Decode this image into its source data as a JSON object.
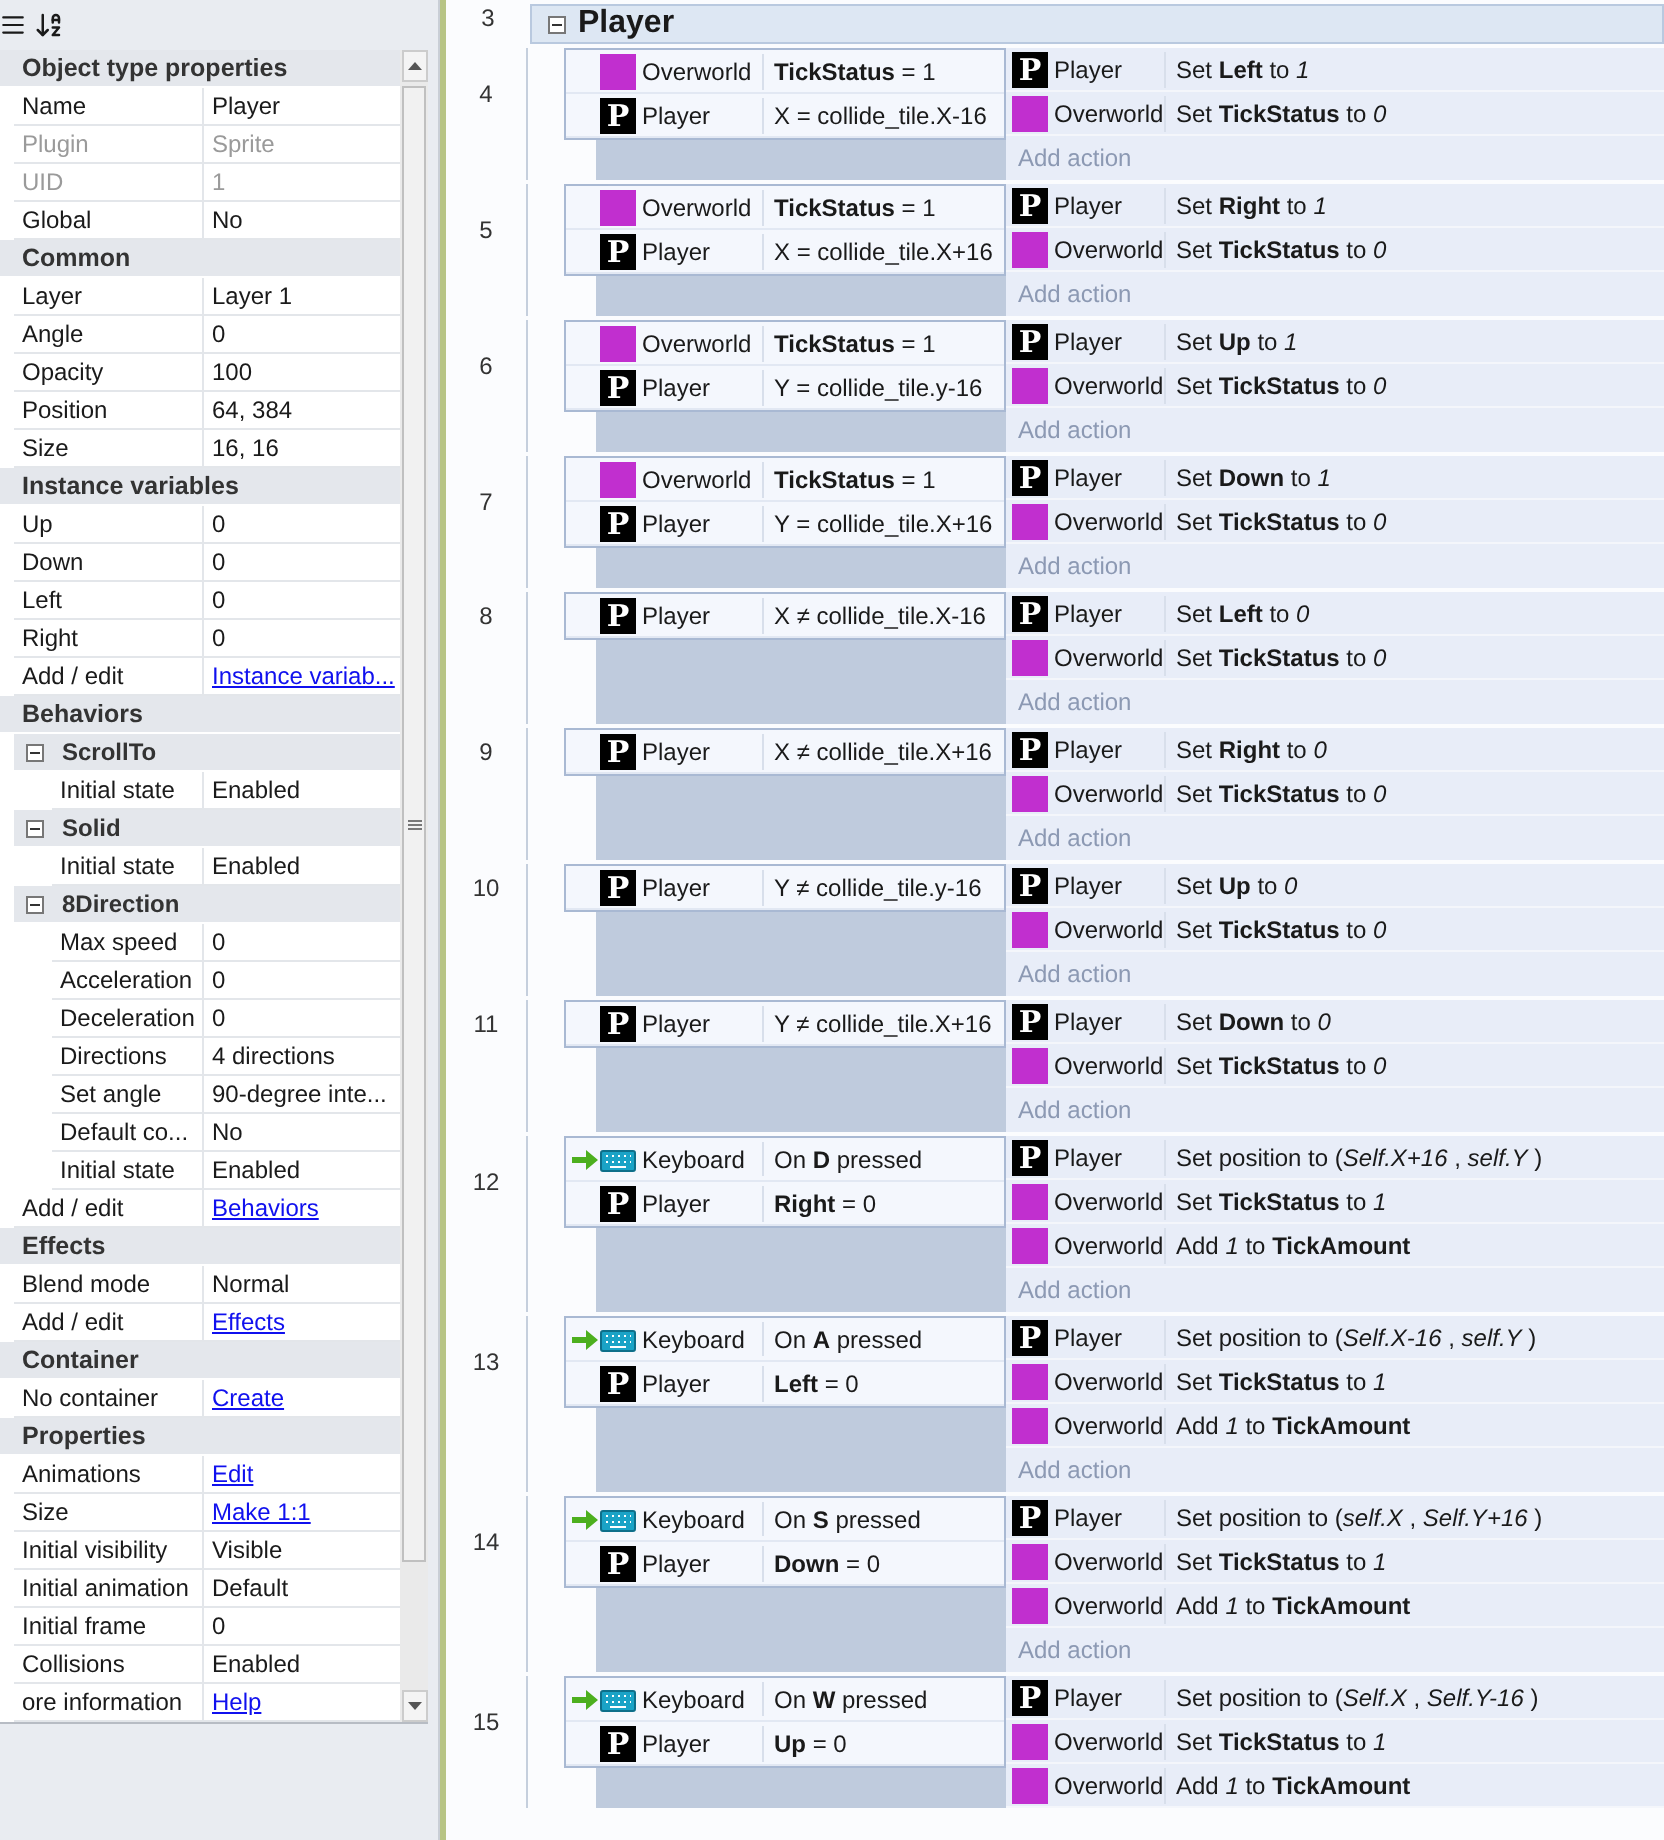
{
  "properties": {
    "sections": [
      {
        "title": "Object type properties",
        "items": [
          {
            "kind": "row",
            "label": "Name",
            "value": "Player",
            "link": false,
            "disabled": false
          },
          {
            "kind": "row",
            "label": "Plugin",
            "value": "Sprite",
            "link": false,
            "disabled": true
          },
          {
            "kind": "row",
            "label": "UID",
            "value": "1",
            "link": false,
            "disabled": true
          },
          {
            "kind": "row",
            "label": "Global",
            "value": "No",
            "link": false,
            "disabled": false
          }
        ]
      },
      {
        "title": "Common",
        "items": [
          {
            "kind": "row",
            "label": "Layer",
            "value": "Layer 1",
            "link": false,
            "disabled": false
          },
          {
            "kind": "row",
            "label": "Angle",
            "value": "0",
            "link": false,
            "disabled": false
          },
          {
            "kind": "row",
            "label": "Opacity",
            "value": "100",
            "link": false,
            "disabled": false
          },
          {
            "kind": "row",
            "label": "Position",
            "value": "64, 384",
            "link": false,
            "disabled": false
          },
          {
            "kind": "row",
            "label": "Size",
            "value": "16, 16",
            "link": false,
            "disabled": false
          }
        ]
      },
      {
        "title": "Instance variables",
        "items": [
          {
            "kind": "row",
            "label": "Up",
            "value": "0",
            "link": false,
            "disabled": false
          },
          {
            "kind": "row",
            "label": "Down",
            "value": "0",
            "link": false,
            "disabled": false
          },
          {
            "kind": "row",
            "label": "Left",
            "value": "0",
            "link": false,
            "disabled": false
          },
          {
            "kind": "row",
            "label": "Right",
            "value": "0",
            "link": false,
            "disabled": false
          },
          {
            "kind": "row",
            "label": "Add / edit",
            "value": "Instance variab...",
            "link": true,
            "disabled": false
          }
        ]
      },
      {
        "title": "Behaviors",
        "items": [
          {
            "kind": "group",
            "name": "ScrollTo",
            "expanded": true,
            "rows": [
              {
                "label": "Initial state",
                "value": "Enabled"
              }
            ]
          },
          {
            "kind": "group",
            "name": "Solid",
            "expanded": true,
            "rows": [
              {
                "label": "Initial state",
                "value": "Enabled"
              }
            ]
          },
          {
            "kind": "group",
            "name": "8Direction",
            "expanded": true,
            "rows": [
              {
                "label": "Max speed",
                "value": "0"
              },
              {
                "label": "Acceleration",
                "value": "0"
              },
              {
                "label": "Deceleration",
                "value": "0"
              },
              {
                "label": "Directions",
                "value": "4 directions"
              },
              {
                "label": "Set angle",
                "value": "90-degree inte..."
              },
              {
                "label": "Default co...",
                "value": "No"
              },
              {
                "label": "Initial state",
                "value": "Enabled"
              }
            ]
          },
          {
            "kind": "row",
            "label": "Add / edit",
            "value": "Behaviors",
            "link": true,
            "disabled": false
          }
        ]
      },
      {
        "title": "Effects",
        "items": [
          {
            "kind": "row",
            "label": "Blend mode",
            "value": "Normal",
            "link": false,
            "disabled": false
          },
          {
            "kind": "row",
            "label": "Add / edit",
            "value": "Effects",
            "link": true,
            "disabled": false
          }
        ]
      },
      {
        "title": "Container",
        "items": [
          {
            "kind": "row",
            "label": "No container",
            "value": "Create",
            "link": true,
            "disabled": false
          }
        ]
      },
      {
        "title": "Properties",
        "items": [
          {
            "kind": "row",
            "label": "Animations",
            "value": "Edit",
            "link": true,
            "disabled": false
          },
          {
            "kind": "row",
            "label": "Size",
            "value": "Make 1:1",
            "link": true,
            "disabled": false
          },
          {
            "kind": "row",
            "label": "Initial visibility",
            "value": "Visible",
            "link": false,
            "disabled": false
          },
          {
            "kind": "row",
            "label": "Initial animation",
            "value": "Default",
            "link": false,
            "disabled": false
          },
          {
            "kind": "row",
            "label": "Initial frame",
            "value": "0",
            "link": false,
            "disabled": false
          },
          {
            "kind": "row",
            "label": "Collisions",
            "value": "Enabled",
            "link": false,
            "disabled": false
          },
          {
            "kind": "row",
            "label": "ore information",
            "value": "Help",
            "link": true,
            "disabled": false
          }
        ]
      }
    ]
  },
  "event_sheet": {
    "group": {
      "line": "3",
      "title": "Player",
      "expanded": true
    },
    "events": [
      {
        "line": "4",
        "conditions": [
          {
            "object": "Overworld",
            "kind": "family",
            "trigger": false,
            "text": "**TickStatus** = 1"
          },
          {
            "object": "Player",
            "kind": "sprite",
            "badge": "P",
            "trigger": false,
            "text": "X = collide_tile.X-16"
          }
        ],
        "actions": [
          {
            "object": "Player",
            "kind": "sprite",
            "badge": "P",
            "text": "Set **Left** to *1*"
          },
          {
            "object": "Overworld",
            "kind": "family",
            "text": "Set **TickStatus** to *0*"
          }
        ],
        "add_action": "Add action"
      },
      {
        "line": "5",
        "conditions": [
          {
            "object": "Overworld",
            "kind": "family",
            "trigger": false,
            "text": "**TickStatus** = 1"
          },
          {
            "object": "Player",
            "kind": "sprite",
            "badge": "P",
            "trigger": false,
            "text": "X = collide_tile.X+16"
          }
        ],
        "actions": [
          {
            "object": "Player",
            "kind": "sprite",
            "badge": "P",
            "text": "Set **Right** to *1*"
          },
          {
            "object": "Overworld",
            "kind": "family",
            "text": "Set **TickStatus** to *0*"
          }
        ],
        "add_action": "Add action"
      },
      {
        "line": "6",
        "conditions": [
          {
            "object": "Overworld",
            "kind": "family",
            "trigger": false,
            "text": "**TickStatus** = 1"
          },
          {
            "object": "Player",
            "kind": "sprite",
            "badge": "P",
            "trigger": false,
            "text": "Y = collide_tile.y-16"
          }
        ],
        "actions": [
          {
            "object": "Player",
            "kind": "sprite",
            "badge": "P",
            "text": "Set **Up** to *1*"
          },
          {
            "object": "Overworld",
            "kind": "family",
            "text": "Set **TickStatus** to *0*"
          }
        ],
        "add_action": "Add action"
      },
      {
        "line": "7",
        "conditions": [
          {
            "object": "Overworld",
            "kind": "family",
            "trigger": false,
            "text": "**TickStatus** = 1"
          },
          {
            "object": "Player",
            "kind": "sprite",
            "badge": "P",
            "trigger": false,
            "text": "Y = collide_tile.X+16"
          }
        ],
        "actions": [
          {
            "object": "Player",
            "kind": "sprite",
            "badge": "P",
            "text": "Set **Down** to *1*"
          },
          {
            "object": "Overworld",
            "kind": "family",
            "text": "Set **TickStatus** to *0*"
          }
        ],
        "add_action": "Add action"
      },
      {
        "line": "8",
        "conditions": [
          {
            "object": "Player",
            "kind": "sprite",
            "badge": "P",
            "trigger": false,
            "text": "X ≠ collide_tile.X-16"
          }
        ],
        "actions": [
          {
            "object": "Player",
            "kind": "sprite",
            "badge": "P",
            "text": "Set **Left** to *0*"
          },
          {
            "object": "Overworld",
            "kind": "family",
            "text": "Set **TickStatus** to *0*"
          }
        ],
        "add_action": "Add action"
      },
      {
        "line": "9",
        "conditions": [
          {
            "object": "Player",
            "kind": "sprite",
            "badge": "P",
            "trigger": false,
            "text": "X ≠ collide_tile.X+16"
          }
        ],
        "actions": [
          {
            "object": "Player",
            "kind": "sprite",
            "badge": "P",
            "text": "Set **Right** to *0*"
          },
          {
            "object": "Overworld",
            "kind": "family",
            "text": "Set **TickStatus** to *0*"
          }
        ],
        "add_action": "Add action"
      },
      {
        "line": "10",
        "conditions": [
          {
            "object": "Player",
            "kind": "sprite",
            "badge": "P",
            "trigger": false,
            "text": "Y ≠ collide_tile.y-16"
          }
        ],
        "actions": [
          {
            "object": "Player",
            "kind": "sprite",
            "badge": "P",
            "text": "Set **Up** to *0*"
          },
          {
            "object": "Overworld",
            "kind": "family",
            "text": "Set **TickStatus** to *0*"
          }
        ],
        "add_action": "Add action"
      },
      {
        "line": "11",
        "conditions": [
          {
            "object": "Player",
            "kind": "sprite",
            "badge": "P",
            "trigger": false,
            "text": "Y ≠ collide_tile.X+16"
          }
        ],
        "actions": [
          {
            "object": "Player",
            "kind": "sprite",
            "badge": "P",
            "text": "Set **Down** to *0*"
          },
          {
            "object": "Overworld",
            "kind": "family",
            "text": "Set **TickStatus** to *0*"
          }
        ],
        "add_action": "Add action"
      },
      {
        "line": "12",
        "conditions": [
          {
            "object": "Keyboard",
            "kind": "keyboard",
            "trigger": true,
            "text": "On **D** pressed"
          },
          {
            "object": "Player",
            "kind": "sprite",
            "badge": "P",
            "trigger": false,
            "text": "**Right** = 0"
          }
        ],
        "actions": [
          {
            "object": "Player",
            "kind": "sprite",
            "badge": "P",
            "text": "Set position to (*Self.X+16* , *self.Y* )"
          },
          {
            "object": "Overworld",
            "kind": "family",
            "text": "Set **TickStatus** to *1*"
          },
          {
            "object": "Overworld",
            "kind": "family",
            "text": "Add *1* to **TickAmount**"
          }
        ],
        "add_action": "Add action"
      },
      {
        "line": "13",
        "conditions": [
          {
            "object": "Keyboard",
            "kind": "keyboard",
            "trigger": true,
            "text": "On **A** pressed"
          },
          {
            "object": "Player",
            "kind": "sprite",
            "badge": "P",
            "trigger": false,
            "text": "**Left** = 0"
          }
        ],
        "actions": [
          {
            "object": "Player",
            "kind": "sprite",
            "badge": "P",
            "text": "Set position to (*Self.X-16* , *self.Y* )"
          },
          {
            "object": "Overworld",
            "kind": "family",
            "text": "Set **TickStatus** to *1*"
          },
          {
            "object": "Overworld",
            "kind": "family",
            "text": "Add *1* to **TickAmount**"
          }
        ],
        "add_action": "Add action"
      },
      {
        "line": "14",
        "conditions": [
          {
            "object": "Keyboard",
            "kind": "keyboard",
            "trigger": true,
            "text": "On **S** pressed"
          },
          {
            "object": "Player",
            "kind": "sprite",
            "badge": "P",
            "trigger": false,
            "text": "**Down** = 0"
          }
        ],
        "actions": [
          {
            "object": "Player",
            "kind": "sprite",
            "badge": "P",
            "text": "Set position to (*self.X* , *Self.Y+16* )"
          },
          {
            "object": "Overworld",
            "kind": "family",
            "text": "Set **TickStatus** to *1*"
          },
          {
            "object": "Overworld",
            "kind": "family",
            "text": "Add *1* to **TickAmount**"
          }
        ],
        "add_action": "Add action"
      },
      {
        "line": "15",
        "conditions": [
          {
            "object": "Keyboard",
            "kind": "keyboard",
            "trigger": true,
            "text": "On **W** pressed"
          },
          {
            "object": "Player",
            "kind": "sprite",
            "badge": "P",
            "trigger": false,
            "text": "**Up** = 0"
          }
        ],
        "actions": [
          {
            "object": "Player",
            "kind": "sprite",
            "badge": "P",
            "text": "Set position to (*Self.X* , *Self.Y-16* )"
          },
          {
            "object": "Overworld",
            "kind": "family",
            "text": "Set **TickStatus** to *1*"
          },
          {
            "object": "Overworld",
            "kind": "family",
            "text": "Add *1* to **TickAmount**"
          }
        ]
      }
    ]
  }
}
